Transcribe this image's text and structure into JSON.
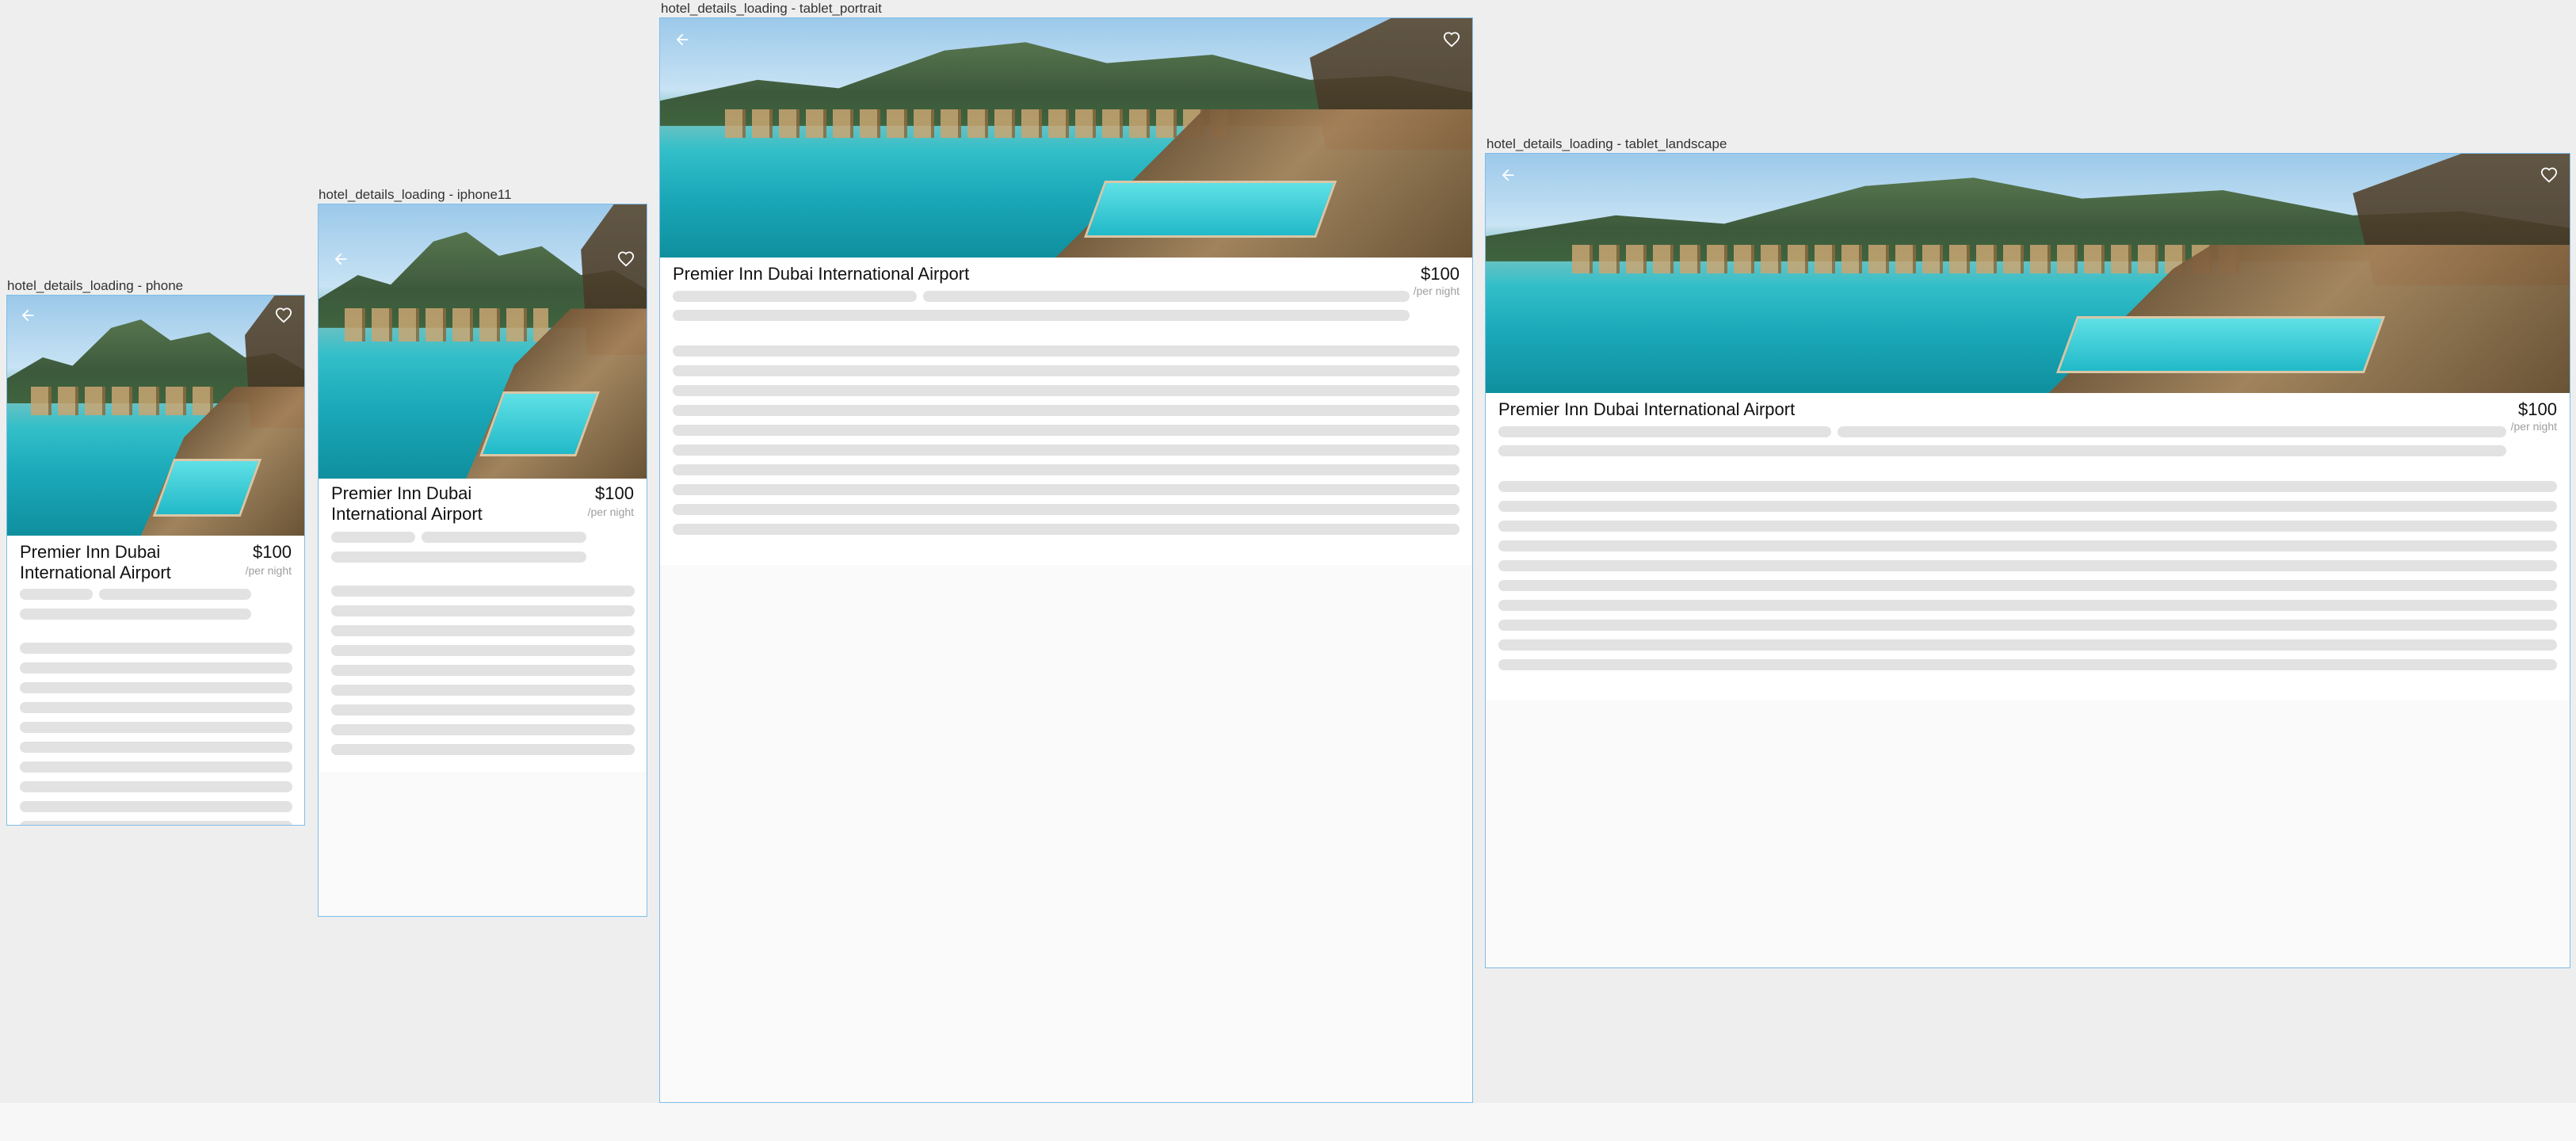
{
  "frames": [
    {
      "id": "phone",
      "label": "hotel_details_loading - phone",
      "hotel_name": "Premier Inn Dubai International Airport",
      "price": "$100",
      "per_night": "/per night"
    },
    {
      "id": "iphone11",
      "label": "hotel_details_loading - iphone11",
      "hotel_name": "Premier Inn Dubai International Airport",
      "price": "$100",
      "per_night": "/per night"
    },
    {
      "id": "tablet_portrait",
      "label": "hotel_details_loading - tablet_portrait",
      "hotel_name": "Premier Inn Dubai International Airport",
      "price": "$100",
      "per_night": "/per night"
    },
    {
      "id": "tablet_landscape",
      "label": "hotel_details_loading - tablet_landscape",
      "hotel_name": "Premier Inn Dubai International Airport",
      "price": "$100",
      "per_night": "/per night"
    }
  ],
  "icons": {
    "back": "arrow-back-icon",
    "favorite": "heart-outline-icon"
  },
  "colors": {
    "canvas_background": "#eeeeee",
    "frame_border": "#7fbde8",
    "skeleton": "#e2e2e2",
    "per_night_text": "#9e9e9e"
  }
}
